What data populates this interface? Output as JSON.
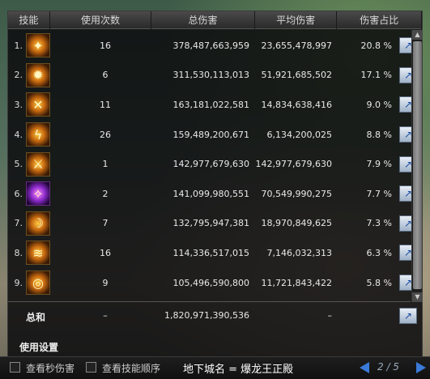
{
  "header": {
    "skill": "技能",
    "count": "使用次数",
    "total": "总伤害",
    "avg": "平均伤害",
    "share": "伤害占比"
  },
  "rows": [
    {
      "idx": "1.",
      "count": "16",
      "total": "378,487,663,959",
      "avg": "23,655,478,997",
      "pct": "20.8 %",
      "icon": "flame-slash-icon"
    },
    {
      "idx": "2.",
      "count": "6",
      "total": "311,530,113,013",
      "avg": "51,921,685,502",
      "pct": "17.1 %",
      "icon": "fire-burst-icon"
    },
    {
      "idx": "3.",
      "count": "11",
      "total": "163,181,022,581",
      "avg": "14,834,638,416",
      "pct": "9.0 %",
      "icon": "cross-blade-icon"
    },
    {
      "idx": "4.",
      "count": "26",
      "total": "159,489,200,671",
      "avg": "6,134,200,025",
      "pct": "8.8 %",
      "icon": "lightning-strike-icon"
    },
    {
      "idx": "5.",
      "count": "1",
      "total": "142,977,679,630",
      "avg": "142,977,679,630",
      "pct": "7.9 %",
      "icon": "sword-rush-icon"
    },
    {
      "idx": "6.",
      "count": "2",
      "total": "141,099,980,551",
      "avg": "70,549,990,275",
      "pct": "7.7 %",
      "icon": "magic-pillar-icon"
    },
    {
      "idx": "7.",
      "count": "7",
      "total": "132,795,947,381",
      "avg": "18,970,849,625",
      "pct": "7.3 %",
      "icon": "arc-slash-icon"
    },
    {
      "idx": "8.",
      "count": "16",
      "total": "114,336,517,015",
      "avg": "7,146,032,313",
      "pct": "6.3 %",
      "icon": "flame-wave-icon"
    },
    {
      "idx": "9.",
      "count": "9",
      "total": "105,496,590,800",
      "avg": "11,721,843,422",
      "pct": "5.8 %",
      "icon": "fire-ring-icon"
    }
  ],
  "totals": {
    "label": "总和",
    "count": "–",
    "total": "1,820,971,390,536",
    "avg": "–"
  },
  "settings_label": "使用设置",
  "footer": {
    "check_dps": "查看秒伤害",
    "check_order": "查看技能顺序",
    "dungeon": "地下城名 = 爆龙王正殿",
    "pager": "2 / 5"
  },
  "colors": {
    "accent_blue": "#3a7ad8",
    "icon_gold": "#ffcc44"
  }
}
